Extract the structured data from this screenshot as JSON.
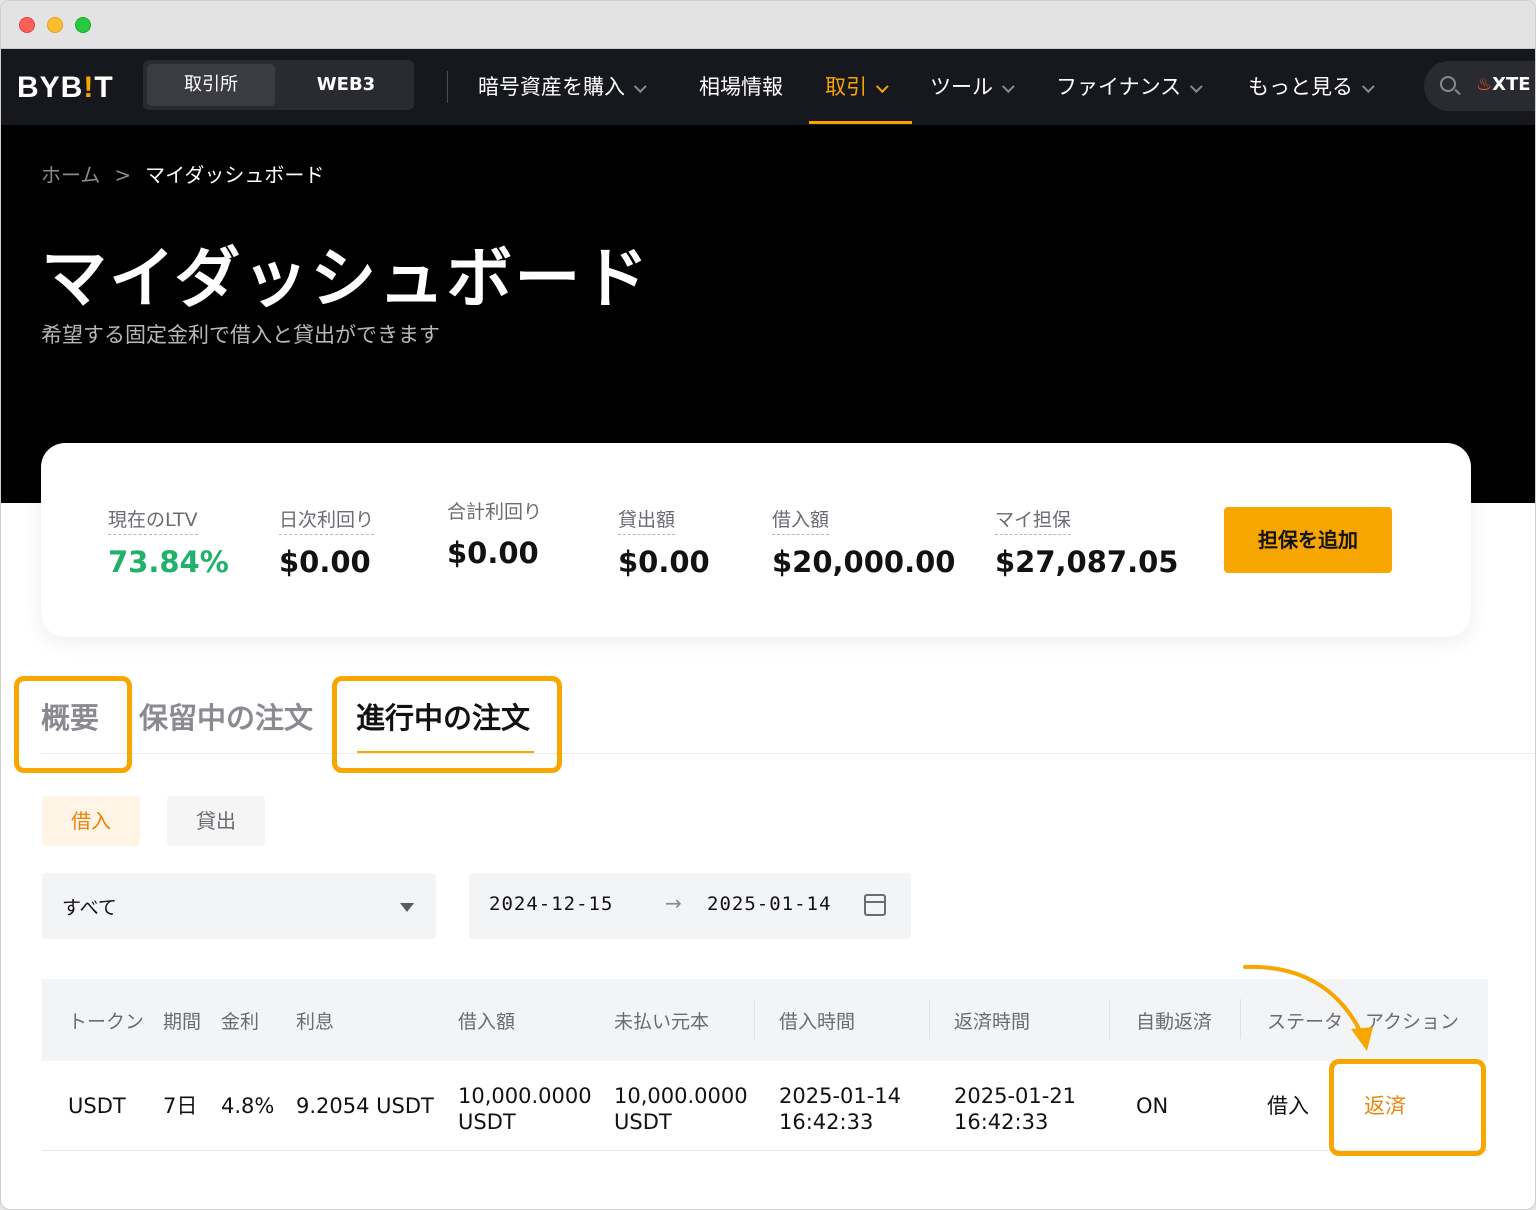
{
  "nav": {
    "logo_prefix": "BYB",
    "logo_bang": "!",
    "logo_suffix": "T",
    "segment": [
      "取引所",
      "WEB3"
    ],
    "items": [
      "暗号資産を購入",
      "相場情報",
      "取引",
      "ツール",
      "ファイナンス",
      "もっと見る"
    ],
    "search_text": "XTE"
  },
  "hero": {
    "breadcrumb_home": "ホーム",
    "breadcrumb_sep": ">",
    "breadcrumb_current": "マイダッシュボード",
    "title": "マイダッシュボード",
    "subtitle": "希望する固定金利で借入と貸出ができます"
  },
  "stats": {
    "ltv_label": "現在のLTV",
    "ltv_value": "73.84%",
    "daily_label": "日次利回り",
    "daily_value": "$0.00",
    "total_label": "合計利回り",
    "total_value": "$0.00",
    "lend_label": "貸出額",
    "lend_value": "$0.00",
    "borrow_label": "借入額",
    "borrow_value": "$20,000.00",
    "collateral_label": "マイ担保",
    "collateral_value": "$27,087.05",
    "add_button": "担保を追加"
  },
  "tabs": {
    "overview": "概要",
    "pending": "保留中の注文",
    "active": "進行中の注文"
  },
  "filters": {
    "borrow": "借入",
    "lend": "貸出",
    "select_value": "すべて",
    "date_from": "2024-12-15",
    "date_arrow": "→",
    "date_to": "2025-01-14"
  },
  "table": {
    "headers": [
      "トークン",
      "期間",
      "金利",
      "利息",
      "借入額",
      "未払い元本",
      "借入時間",
      "返済時間",
      "自動返済",
      "ステータ",
      "アクション"
    ],
    "row": {
      "token": "USDT",
      "term": "7日",
      "rate": "4.8%",
      "interest": "9.2054 USDT",
      "borrow_amount_1": "10,000.0000",
      "borrow_amount_2": "USDT",
      "unpaid_1": "10,000.0000",
      "unpaid_2": "USDT",
      "borrow_time_1": "2025-01-14",
      "borrow_time_2": "16:42:33",
      "repay_time_1": "2025-01-21",
      "repay_time_2": "16:42:33",
      "auto_repay": "ON",
      "status": "借入",
      "action": "返済"
    }
  },
  "colors": {
    "accent": "#f7a600",
    "highlight": "#f7a600",
    "ltv_green": "#20b26c",
    "action_orange": "#e8850c"
  }
}
